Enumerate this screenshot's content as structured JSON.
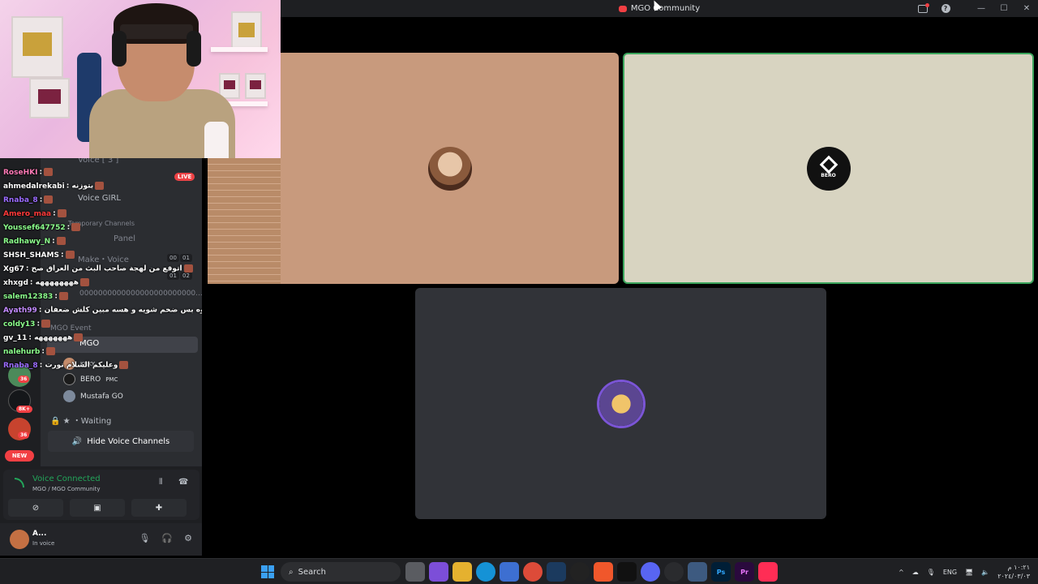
{
  "window": {
    "title": "MGO Community"
  },
  "sidebar": {
    "voice_header": "Voice [ 3 ]",
    "voice_girl": "Voice GIRL",
    "temporary": "Temporary Channels",
    "panel": "Panel",
    "make_voice": "Make・Voice",
    "long_channel": "0000000000000000000000000...",
    "event": "MGO Event",
    "mgo_channel": "MGO",
    "waiting": "Waiting",
    "live": "LIVE",
    "timer_1a": "00",
    "timer_1b": "01",
    "timer_2a": "01",
    "timer_2b": "02",
    "users": [
      {
        "name": "KRKY",
        "tag": ""
      },
      {
        "name": "BERO",
        "tag": "PMC"
      },
      {
        "name": "Mustafa GO",
        "tag": ""
      }
    ],
    "hide_voice": "Hide Voice Channels",
    "badges": {
      "b1": "36",
      "b2": "8K+",
      "b3": "36"
    },
    "new_pill": "NEW"
  },
  "voice_panel": {
    "status": "Voice Connected",
    "location": "MGO / MGO Community"
  },
  "user_panel": {
    "name": "A...",
    "status": "In voice"
  },
  "chat": [
    {
      "user": "RoseHKI",
      "color": "#ff7ab6",
      "msg": ":"
    },
    {
      "user": "ahmedalrekabi",
      "color": "#ffffff",
      "msg": ": بتوزنه"
    },
    {
      "user": "Rnaba_8",
      "color": "#9b6bff",
      "msg": ":"
    },
    {
      "user": "Amero_maa",
      "color": "#ff3a3a",
      "msg": ":"
    },
    {
      "user": "Youssef647752",
      "color": "#8cff8c",
      "msg": ":"
    },
    {
      "user": "Radhawy_N",
      "color": "#8cff8c",
      "msg": ":"
    },
    {
      "user": "SHSH_SHAMS",
      "color": "#ffffff",
      "msg": ":"
    },
    {
      "user": "Xg67",
      "color": "#ffffff",
      "msg": ": اتوقع من لهجة صاحب البث من العراق صح"
    },
    {
      "user": "xhxgd",
      "color": "#ffffff",
      "msg": ": ههههههههه"
    },
    {
      "user": "salem12383",
      "color": "#8cff8c",
      "msg": ":"
    },
    {
      "user": "Ayath99",
      "color": "#c38bff",
      "msg": ": ترى والله سالار مو سمين هوه بس ضخم شويه و هسه مبين كلش ضعفان"
    },
    {
      "user": "coldy13",
      "color": "#8cff8c",
      "msg": ":"
    },
    {
      "user": "gv_11",
      "color": "#ffffff",
      "msg": ": هههههههه"
    },
    {
      "user": "nalehurb",
      "color": "#8cff8c",
      "msg": ":"
    },
    {
      "user": "Rnaba_8",
      "color": "#9b6bff",
      "msg": ": وعليكم السلام نورت"
    }
  ],
  "tiles": {
    "tile2_label": "BERO"
  },
  "taskbar": {
    "search": "Search",
    "lang": "ENG",
    "time": "١٠:٢١ م",
    "date": "٢٠٢٤/٠٣/٠٣",
    "apps": [
      "files",
      "copilot",
      "explorer",
      "edge",
      "store",
      "chrome",
      "steam",
      "obs",
      "brave",
      "capcut",
      "discord",
      "chatgpt",
      "snip",
      "Ps",
      "Pr",
      "tiktok"
    ]
  },
  "colors": {
    "accent": "#5865f2",
    "green": "#23a55a",
    "red": "#f23f43"
  }
}
